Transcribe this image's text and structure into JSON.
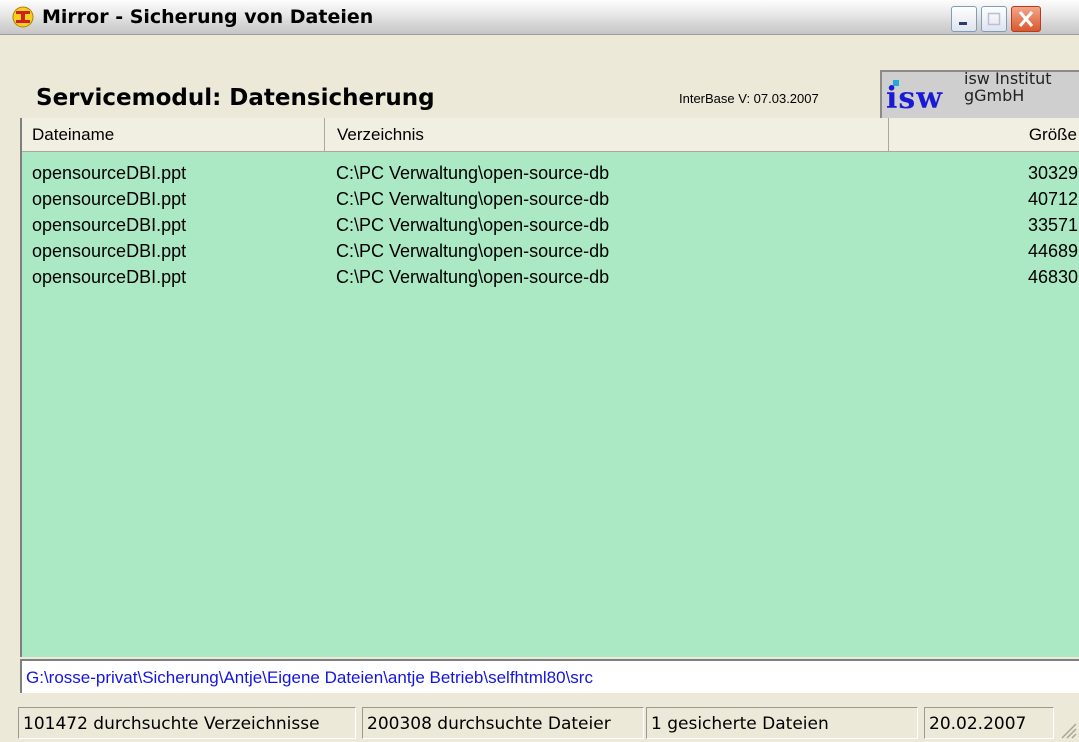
{
  "window": {
    "title": "Mirror - Sicherung von Dateien",
    "icon": "mirror-app-icon"
  },
  "header": {
    "title": "Servicemodul: Datensicherung",
    "version": "InterBase V: 07.03.2007",
    "logo_text": "isw",
    "logo_company_line1": "isw Institut",
    "logo_company_line2": "gGmbH"
  },
  "list": {
    "columns": [
      "Dateiname",
      "Verzeichnis",
      "Größe"
    ],
    "rows": [
      {
        "name": "opensourceDBI.ppt",
        "dir": "C:\\PC Verwaltung\\open-source-db",
        "size": "30329"
      },
      {
        "name": "opensourceDBI.ppt",
        "dir": "C:\\PC Verwaltung\\open-source-db",
        "size": "40712"
      },
      {
        "name": "opensourceDBI.ppt",
        "dir": "C:\\PC Verwaltung\\open-source-db",
        "size": "33571"
      },
      {
        "name": "opensourceDBI.ppt",
        "dir": "C:\\PC Verwaltung\\open-source-db",
        "size": "44689"
      },
      {
        "name": "opensourceDBI.ppt",
        "dir": "C:\\PC Verwaltung\\open-source-db",
        "size": "46830"
      }
    ],
    "background_color": "#abe8c4"
  },
  "path": "G:\\rosse-privat\\Sicherung\\Antje\\Eigene Dateien\\antje Betrieb\\selfhtml80\\src",
  "status": {
    "dirs": "101472 durchsuchte Verzeichnisse",
    "files": "200308 durchsuchte Dateier",
    "saved": "1 gesicherte Dateien",
    "date": "20.02.2007"
  },
  "colors": {
    "path_text": "#1515e0",
    "logo_text": "#1a1ad6",
    "close_button": "#d9592d"
  }
}
